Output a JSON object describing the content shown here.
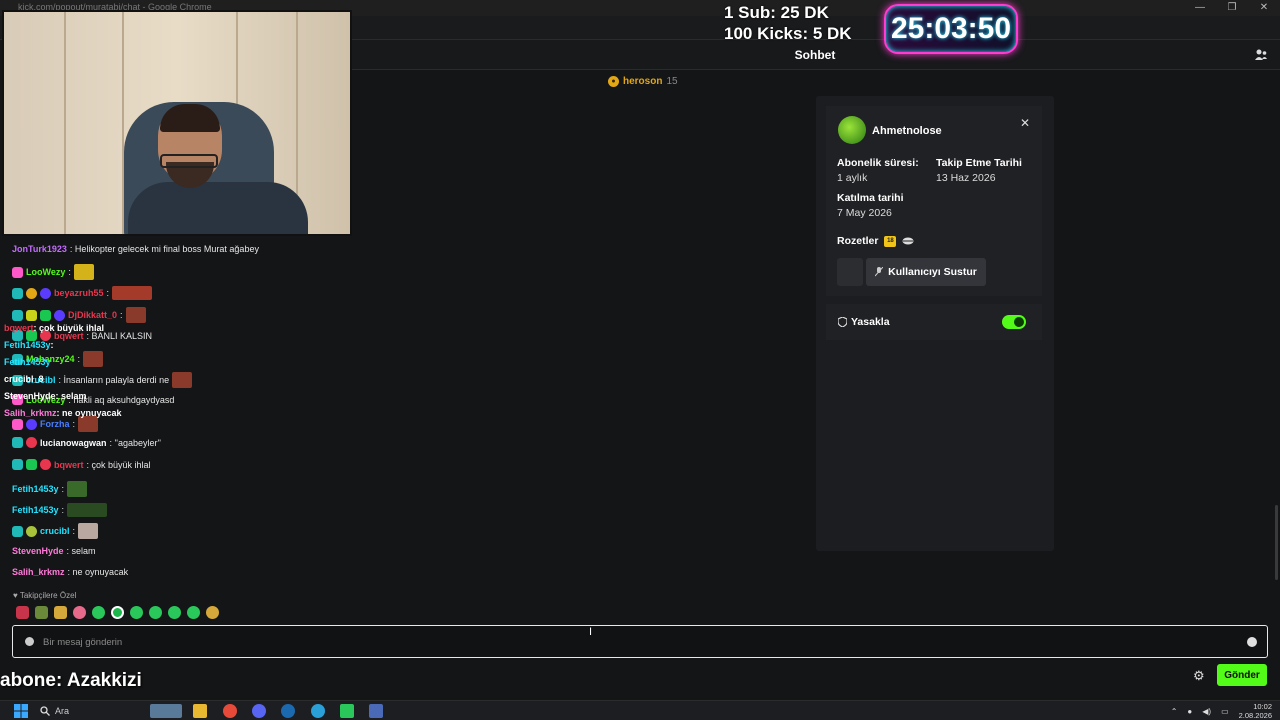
{
  "browser": {
    "url_title": "kick.com/popout/muratabi/chat - Google Chrome",
    "controls": [
      "—",
      "❐",
      "✕"
    ]
  },
  "stream_overlay": {
    "goal_line1": "1 Sub: 25 DK",
    "goal_line2": "100 Kicks: 5 DK",
    "timer": "25:03:50",
    "bottom_text": "abone: Azakkizi"
  },
  "chat_header": {
    "title": "Sohbet"
  },
  "pinned_gifter": {
    "name": "heroson",
    "count": "15"
  },
  "messages": [
    {
      "user": "JonTurk1923",
      "text": ": Helikopter gelecek mi final boss Murat ağabey",
      "color": "#c46cff"
    },
    {
      "user": "LooWezy",
      "text": ":",
      "color": "#53fc18"
    },
    {
      "user": "beyazruh55",
      "text": ":",
      "color": "#e8364f"
    },
    {
      "user": "DjDikkatt_0",
      "text": ":",
      "color": "#e8364f"
    },
    {
      "user": "bqwert",
      "text": ": BANLI KALSIN",
      "color": "#e8364f"
    },
    {
      "user": "Mobanzy24",
      "text": ":",
      "color": "#53fc18"
    },
    {
      "user": "crucibl",
      "text": ": İnsanların palayla derdi ne",
      "color": "#23e4ff"
    },
    {
      "user": "LooWezy",
      "text": ": hakli aq aksuhdgaydyasd",
      "color": "#53fc18"
    },
    {
      "user": "Forzha",
      "text": ":",
      "color": "#4a7dff"
    },
    {
      "user": "lucianowagwan",
      "text": ": ''agabeyler''",
      "color": "#ffffff"
    },
    {
      "user": "bqwert",
      "text": ": çok büyük ihlal",
      "color": "#e8364f"
    },
    {
      "user": "Fetih1453y",
      "text": ":",
      "color": "#23e4ff"
    },
    {
      "user": "Fetih1453y",
      "text": ":",
      "color": "#23e4ff"
    },
    {
      "user": "crucibl",
      "text": ":",
      "color": "#23e4ff"
    },
    {
      "user": "StevenHyde",
      "text": ": selam",
      "color": "#ff7ad9"
    },
    {
      "user": "Salih_krkmz",
      "text": ": ne oynuyacak",
      "color": "#ff7ad9"
    }
  ],
  "ghost_messages": [
    {
      "user": "bqwert",
      "text": ": çok büyük ihlal"
    },
    {
      "user": "Fetih1453y",
      "text": ":"
    },
    {
      "user": "Fetih1453y",
      "text": ""
    },
    {
      "user": "crucibl_8",
      "text": ""
    },
    {
      "user": "StevenHyde",
      "text": ": selam"
    },
    {
      "user": "Salih_krkmz",
      "text": ": ne oynuyacak"
    }
  ],
  "followers_note": "♥ Takipçilere Özel",
  "user_card": {
    "username": "Ahmetnolose",
    "sub_label": "Abonelik süresi:",
    "sub_value": "1 aylık",
    "follow_label": "Takip Etme Tarihi",
    "follow_value": "13 Haz 2026",
    "join_label": "Katılma tarihi",
    "join_value": "7 May 2026",
    "badges_label": "Rozetler",
    "badge_value": "18",
    "mute_label": "Kullanıcıyı Sustur",
    "ban_label": "Yasakla",
    "close": "✕"
  },
  "input": {
    "placeholder": "Bir mesaj gönderin"
  },
  "send_label": "Gönder",
  "taskbar": {
    "search_label": "Ara",
    "time": "10:02",
    "date": "2.08.2026"
  }
}
